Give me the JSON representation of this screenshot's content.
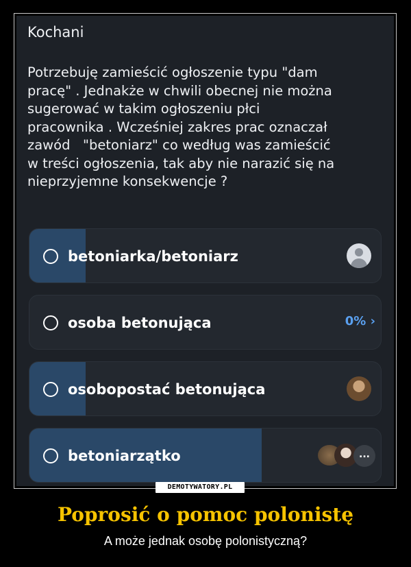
{
  "post": {
    "greeting": "Kochani",
    "message": "Potrzebuję zamieścić ogłoszenie typu \"dam\npracę\" . Jednakże w chwili obecnej nie można\nsugerować w takim ogłoszeniu płci\npracownika . Wcześniej zakres prac oznaczał\nzawód   \"betoniarz\" co według was zamieścić\nw treści ogłoszenia, tak aby nie narazić się na\nnieprzyjemne konsekwencje ?"
  },
  "poll": {
    "options": [
      {
        "label": "betoniarka/betoniarz",
        "share": 0.16,
        "voter": "default-avatar"
      },
      {
        "label": "osoba betonująca",
        "share": 0.0,
        "percent_text": "0%",
        "chevron": "›"
      },
      {
        "label": "osobopostać betonująca",
        "share": 0.16,
        "voter": "photo-avatar"
      },
      {
        "label": "betoniarzątko",
        "share": 0.66,
        "voters_more": "..."
      }
    ]
  },
  "watermark": "DEMOTYWATORY.PL",
  "caption": {
    "title": "Poprosić o pomoc polonistę",
    "subtitle": "A może jednak osobę polonistyczną?"
  },
  "colors": {
    "title": "#f6c300",
    "bar_fill": "#2a4868",
    "percent": "#5aa0f0"
  }
}
